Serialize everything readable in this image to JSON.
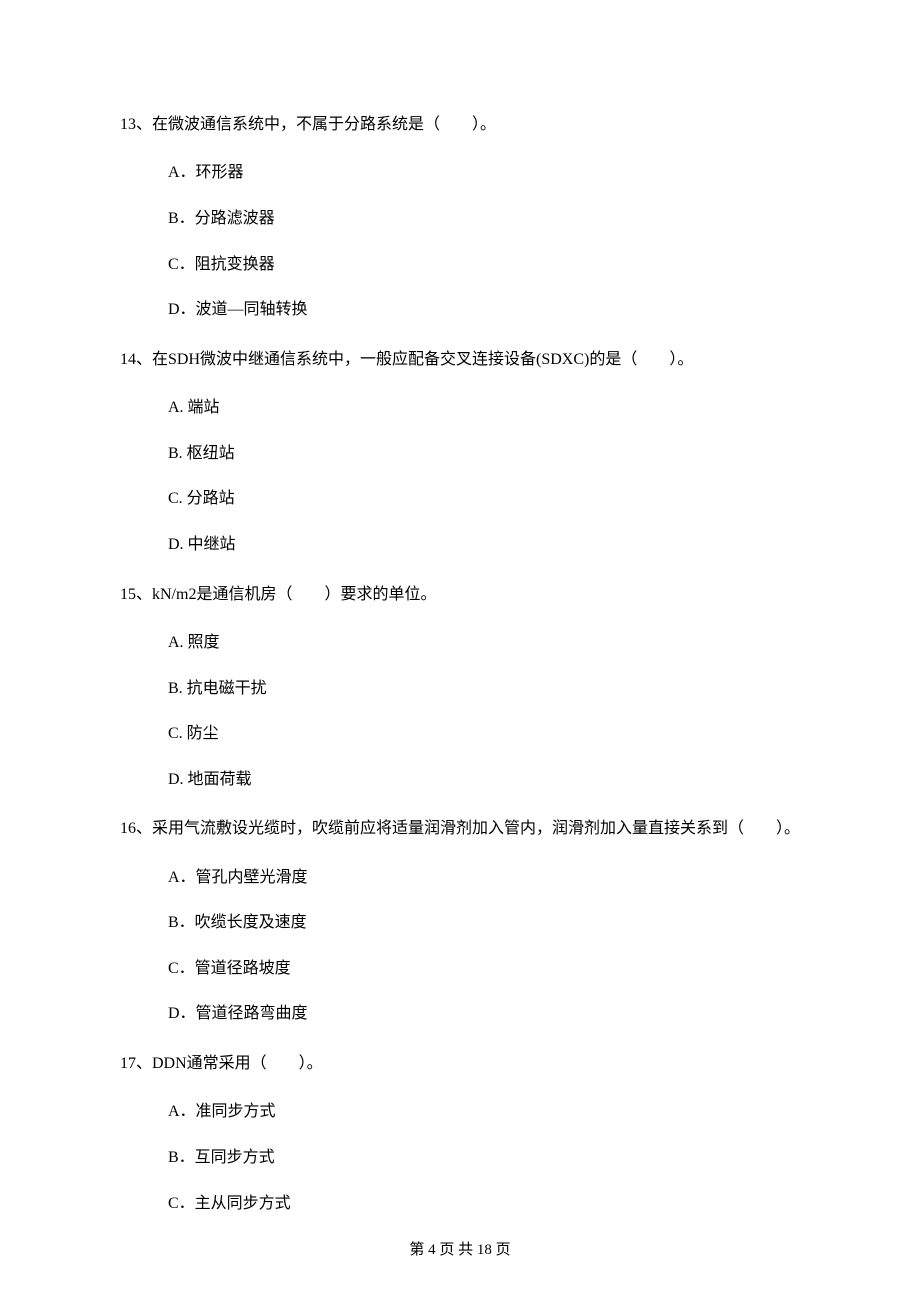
{
  "questions": [
    {
      "number": "13",
      "text": "13、在微波通信系统中，不属于分路系统是（　　）。",
      "options": [
        "A．环形器",
        "B．分路滤波器",
        "C．阻抗变换器",
        "D．波道—同轴转换"
      ]
    },
    {
      "number": "14",
      "text": "14、在SDH微波中继通信系统中，一般应配备交叉连接设备(SDXC)的是（　　）。",
      "options": [
        "A. 端站",
        "B. 枢纽站",
        "C. 分路站",
        "D. 中继站"
      ]
    },
    {
      "number": "15",
      "text": "15、kN/m2是通信机房（　　）要求的单位。",
      "options": [
        "A. 照度",
        "B. 抗电磁干扰",
        "C. 防尘",
        "D. 地面荷载"
      ]
    },
    {
      "number": "16",
      "text": "16、采用气流敷设光缆时，吹缆前应将适量润滑剂加入管内，润滑剂加入量直接关系到（　　）。",
      "options": [
        "A．管孔内壁光滑度",
        "B．吹缆长度及速度",
        "C．管道径路坡度",
        "D．管道径路弯曲度"
      ]
    },
    {
      "number": "17",
      "text": "17、DDN通常采用（　　）。",
      "options": [
        "A．准同步方式",
        "B．互同步方式",
        "C．主从同步方式"
      ]
    }
  ],
  "footer": "第 4 页 共 18 页"
}
